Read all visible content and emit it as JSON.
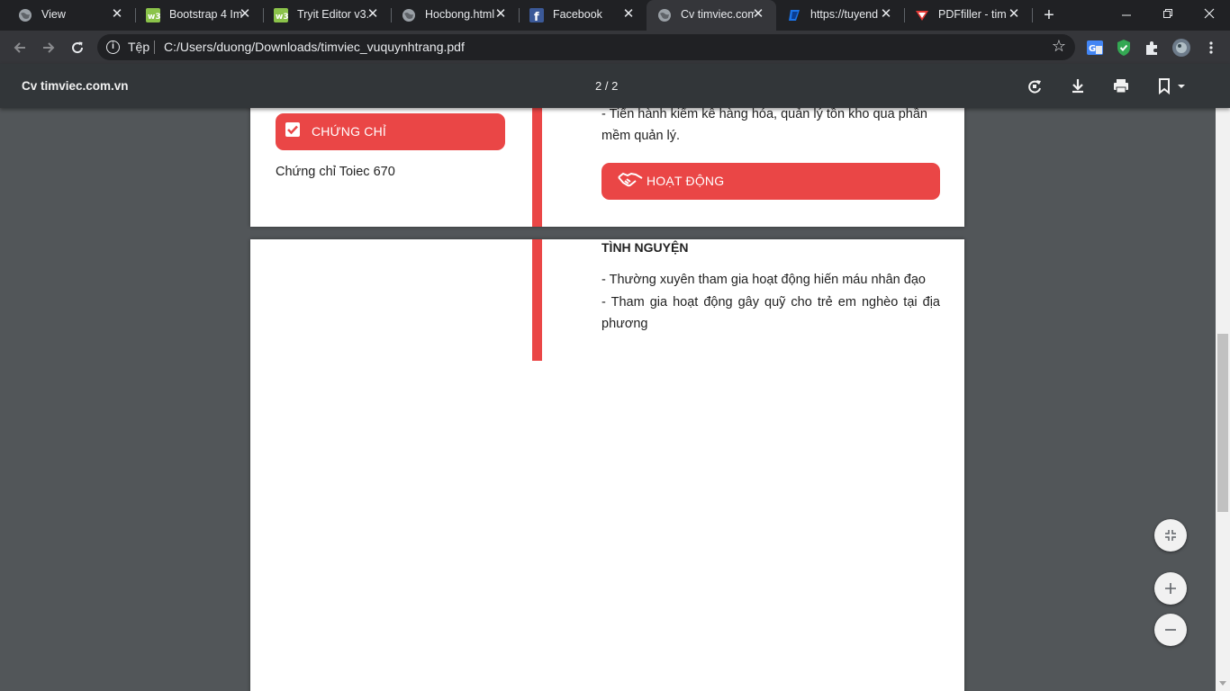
{
  "tabs": [
    {
      "title": "View",
      "icon": "globe-icon"
    },
    {
      "title": "Bootstrap 4 Im",
      "icon": "w3schools-icon"
    },
    {
      "title": "Tryit Editor v3.",
      "icon": "w3schools-icon"
    },
    {
      "title": "Hocbong.html",
      "icon": "globe-icon"
    },
    {
      "title": "Facebook",
      "icon": "facebook-icon"
    },
    {
      "title": "Cv timviec.com",
      "icon": "globe-icon"
    },
    {
      "title": "https://tuyend",
      "icon": "timviec-icon"
    },
    {
      "title": "PDFfiller - tim",
      "icon": "pdffiller-icon"
    }
  ],
  "address": {
    "scheme": "Tệp",
    "url": "C:/Users/duong/Downloads/timviec_vuquynhtrang.pdf"
  },
  "pdf": {
    "title": "Cv timviec.com.vn",
    "page_indicator": "2 / 2"
  },
  "document": {
    "cut_text_top": "- Tiến hành kiểm kê hàng hóa, quản lý tồn kho qua phần",
    "cut_text_cont": "mềm quản lý.",
    "cert_heading": "CHỨNG CHỈ",
    "cert_item": "Chứng chỉ Toiec 670",
    "activity_heading": "HOẠT ĐỘNG",
    "volunteer_title": "TÌNH NGUYỆN",
    "volunteer_line1": "- Thường xuyên tham gia hoạt động hiến máu nhân đạo",
    "volunteer_line2": "- Tham gia hoạt động gây quỹ cho trẻ em nghèo tại địa",
    "volunteer_line3": "phương"
  },
  "colors": {
    "accent_red": "#ea4646",
    "viewer_bg": "#525659",
    "tab_bg": "#202124",
    "toolbar_bg": "#35363a"
  }
}
